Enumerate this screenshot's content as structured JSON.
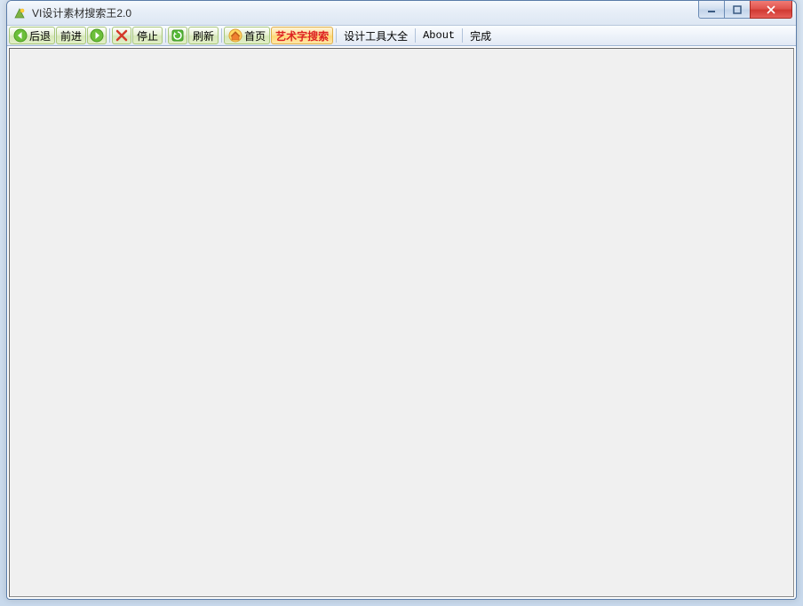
{
  "title": "VI设计素材搜索王2.0",
  "toolbar": {
    "back": "后退",
    "forward": "前进",
    "stop": "停止",
    "refresh": "刷新",
    "home": "首页",
    "art_search": "艺术字搜索",
    "tools": "设计工具大全",
    "about": "About",
    "status": "完成"
  }
}
